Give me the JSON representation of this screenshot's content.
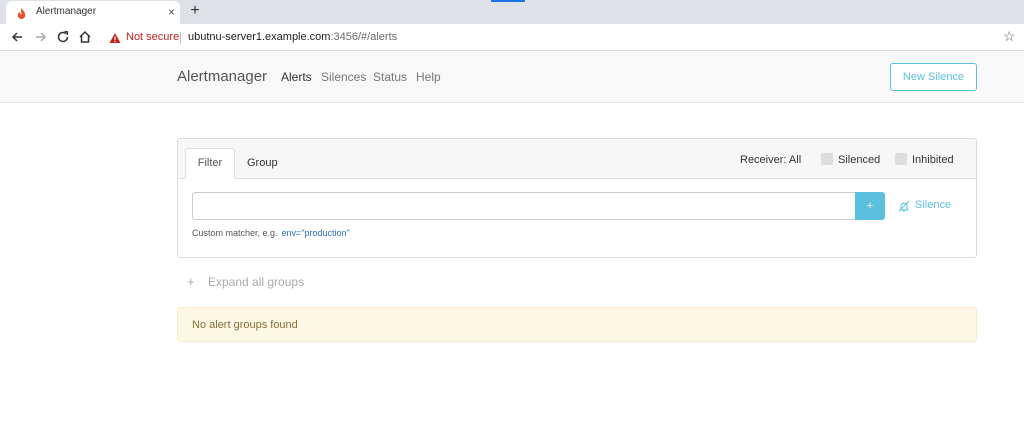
{
  "browser": {
    "tab_title": "Alertmanager",
    "tab_close": "×",
    "new_tab": "+",
    "security_label": "Not secure",
    "separator": "|",
    "url_host": "ubutnu-server1.example.com",
    "url_rest": ":3456/#/alerts",
    "bookmark_star": "☆"
  },
  "navbar": {
    "brand": "Alertmanager",
    "links": [
      "Alerts",
      "Silences",
      "Status",
      "Help"
    ],
    "active_link": "Alerts",
    "new_silence_label": "New Silence"
  },
  "filter_card": {
    "tabs": [
      "Filter",
      "Group"
    ],
    "active_tab": "Filter",
    "receiver_label": "Receiver: All",
    "checkboxes": [
      {
        "label": "Silenced",
        "checked": false
      },
      {
        "label": "Inhibited",
        "checked": false
      }
    ],
    "input_value": "",
    "add_button": "+",
    "silence_link": "Silence",
    "hint_text": "Custom matcher, e.g.",
    "hint_example": "env=\"production\""
  },
  "expand_all": {
    "icon": "+",
    "label": "Expand all groups"
  },
  "empty_state": "No alert groups found",
  "colors": {
    "accent": "#5bc0de",
    "warning_bg": "#fcf8e3",
    "warning_text": "#8a6d3b",
    "not_secure": "#c5221f"
  }
}
